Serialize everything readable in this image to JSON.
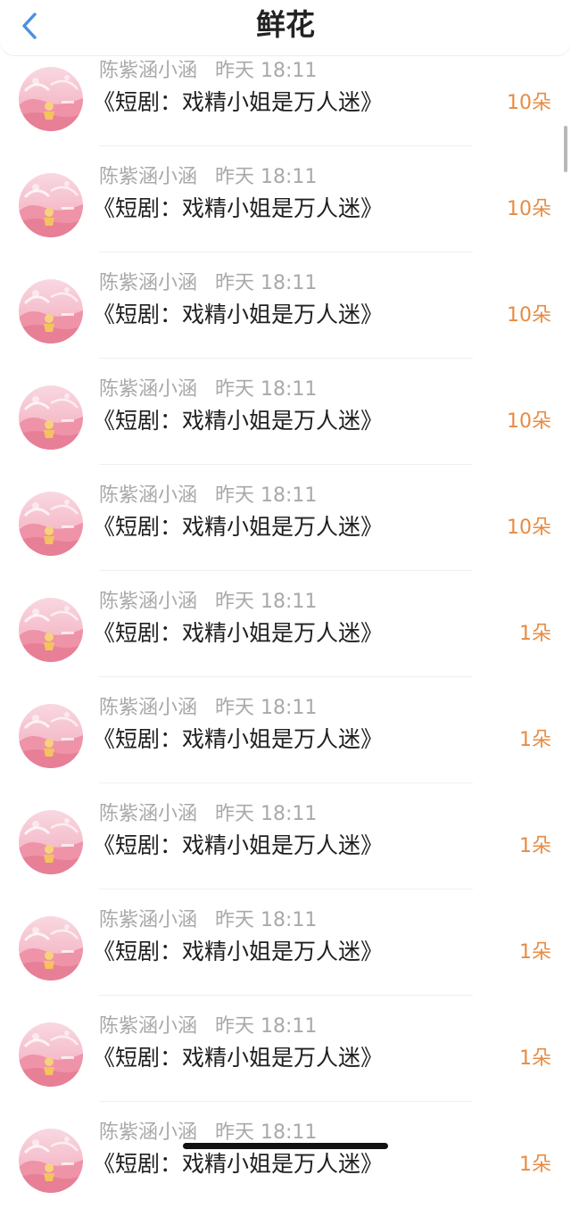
{
  "header": {
    "title": "鲜花",
    "back_icon": "chevron-left-icon"
  },
  "records": [
    {
      "user": "陈紫涵小涵",
      "time": "昨天 18:11",
      "drama": "《短剧：戏精小姐是万人迷》",
      "amount": "10朵"
    },
    {
      "user": "陈紫涵小涵",
      "time": "昨天 18:11",
      "drama": "《短剧：戏精小姐是万人迷》",
      "amount": "10朵"
    },
    {
      "user": "陈紫涵小涵",
      "time": "昨天 18:11",
      "drama": "《短剧：戏精小姐是万人迷》",
      "amount": "10朵"
    },
    {
      "user": "陈紫涵小涵",
      "time": "昨天 18:11",
      "drama": "《短剧：戏精小姐是万人迷》",
      "amount": "10朵"
    },
    {
      "user": "陈紫涵小涵",
      "time": "昨天 18:11",
      "drama": "《短剧：戏精小姐是万人迷》",
      "amount": "10朵"
    },
    {
      "user": "陈紫涵小涵",
      "time": "昨天 18:11",
      "drama": "《短剧：戏精小姐是万人迷》",
      "amount": "1朵"
    },
    {
      "user": "陈紫涵小涵",
      "time": "昨天 18:11",
      "drama": "《短剧：戏精小姐是万人迷》",
      "amount": "1朵"
    },
    {
      "user": "陈紫涵小涵",
      "time": "昨天 18:11",
      "drama": "《短剧：戏精小姐是万人迷》",
      "amount": "1朵"
    },
    {
      "user": "陈紫涵小涵",
      "time": "昨天 18:11",
      "drama": "《短剧：戏精小姐是万人迷》",
      "amount": "1朵"
    },
    {
      "user": "陈紫涵小涵",
      "time": "昨天 18:11",
      "drama": "《短剧：戏精小姐是万人迷》",
      "amount": "1朵"
    },
    {
      "user": "陈紫涵小涵",
      "time": "昨天 18:11",
      "drama": "《短剧：戏精小姐是万人迷》",
      "amount": "1朵"
    }
  ],
  "colors": {
    "accent": "#e88b42",
    "back_icon": "#4a90e2",
    "avatar_pink": "#f2a7b8"
  }
}
